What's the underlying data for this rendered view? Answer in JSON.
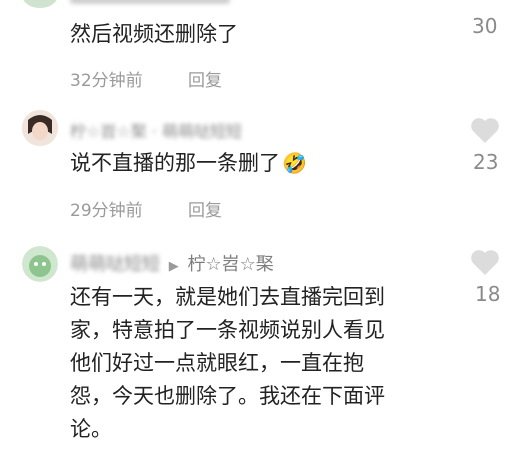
{
  "comments": [
    {
      "text": "然后视频还删除了",
      "time": "32分钟前",
      "reply": "回复",
      "likes": "30"
    },
    {
      "username": "柠☆岧☆棸 · 萌萌哒短短",
      "text": "说不直播的那一条删了",
      "emoji": "🤣",
      "time": "29分钟前",
      "reply": "回复",
      "likes": "23"
    },
    {
      "username": "萌萌哒短短",
      "reply_arrow": "▶",
      "reply_target": "柠☆岧☆棸",
      "text_lines": [
        "还有一天，就是她们去直播完回到",
        "家，特意拍了一条视频说别人看见",
        "他们好过一点就眼红，一直在抱",
        "怨，今天也删除了。我还在下面评",
        "论。"
      ],
      "likes": "18"
    }
  ],
  "colors": {
    "heart": "#dcdcdc",
    "meta": "#9a9a9a"
  }
}
